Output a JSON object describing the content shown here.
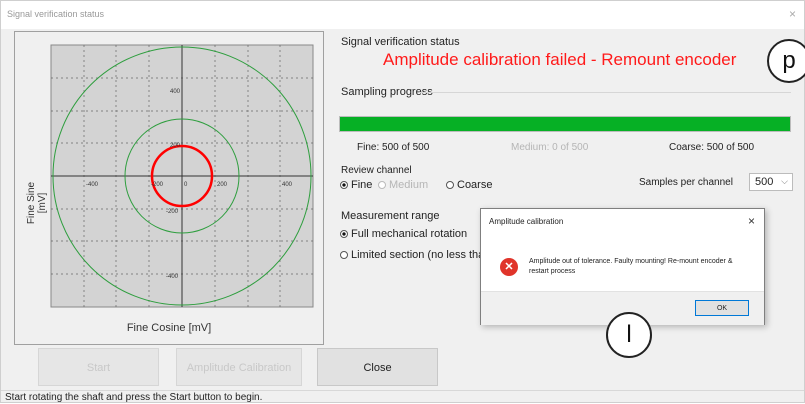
{
  "window": {
    "title": "Signal verification status",
    "close_glyph": "×"
  },
  "plot": {
    "ylabel": "Fine Sine [mV]",
    "xlabel": "Fine Cosine [mV]",
    "x_ticks": [
      "-400",
      "-200",
      "0",
      "200",
      "400"
    ],
    "y_ticks": [
      "400",
      "200",
      "-200",
      "-400"
    ],
    "colors": {
      "background": "#d3d3d3",
      "red_circle": "#ff0000",
      "green_circle": "#2e9e3e",
      "axes": "#333333"
    }
  },
  "status": {
    "label": "Signal verification status",
    "message": "Amplitude calibration failed - Remount encoder"
  },
  "sampling": {
    "label": "Sampling progress",
    "progress_fraction": 1.0,
    "fine": "Fine: 500 of 500",
    "medium": "Medium: 0 of 500",
    "coarse": "Coarse: 500 of 500"
  },
  "review": {
    "label": "Review channel",
    "options": [
      "Fine",
      "Medium",
      "Coarse"
    ],
    "selected": "Fine"
  },
  "samples_per_channel": {
    "label": "Samples per channel",
    "value": "500"
  },
  "measurement_range": {
    "label": "Measurement range",
    "options": [
      "Full mechanical rotation",
      "Limited section (no less tha"
    ]
  },
  "buttons": {
    "start": "Start",
    "amp_cal": "Amplitude Calibration",
    "close": "Close"
  },
  "status_bar": "Start rotating the shaft and press the Start button to begin.",
  "dialog": {
    "title": "Amplitude calibration",
    "close_glyph": "×",
    "message": "Amplitude out of tolerance. Faulty mounting! Re-mount encoder & restart process",
    "ok": "OK"
  },
  "badges": {
    "p": "p",
    "l": "l"
  }
}
